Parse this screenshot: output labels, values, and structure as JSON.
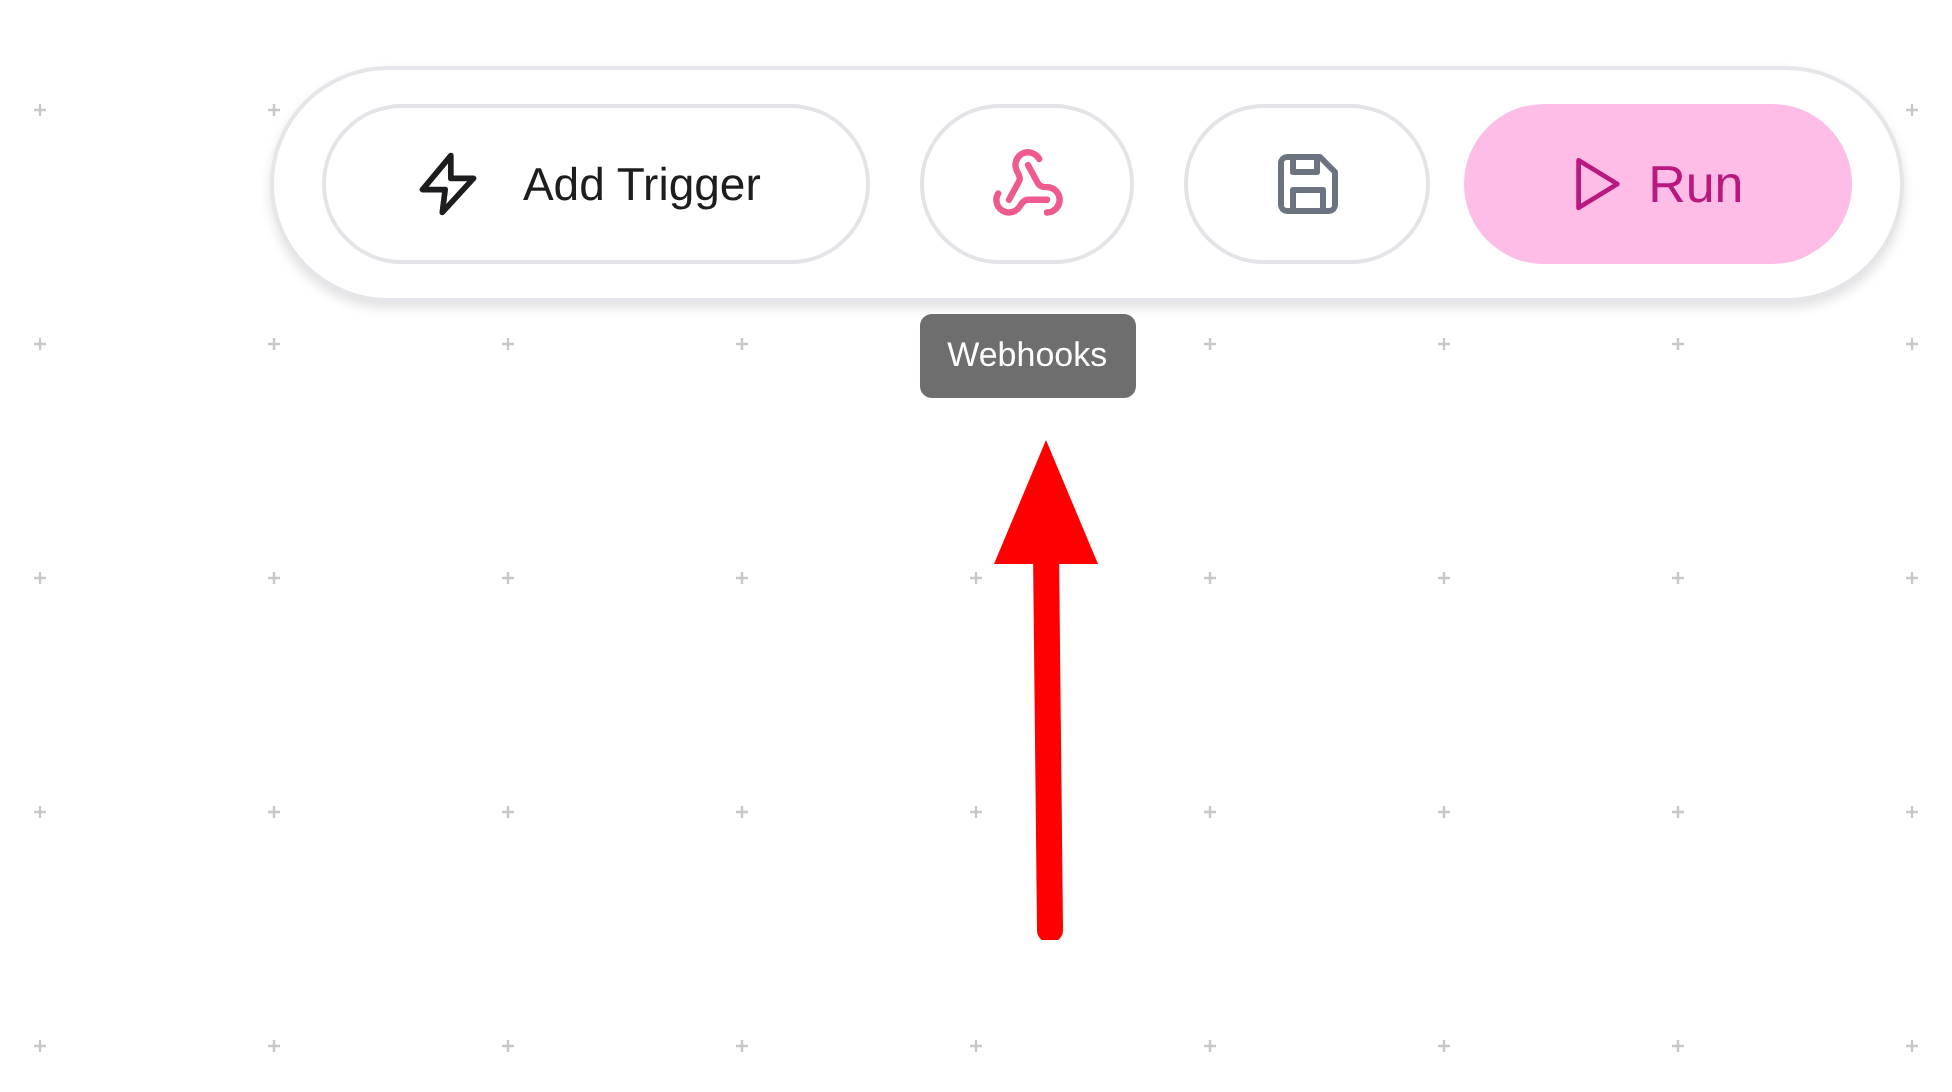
{
  "toolbar": {
    "buttons": [
      {
        "kind": "trigger",
        "label": "Add Trigger"
      },
      {
        "kind": "webhooks",
        "tooltip": "Webhooks"
      },
      {
        "kind": "save"
      },
      {
        "kind": "run",
        "label": "Run"
      }
    ]
  }
}
